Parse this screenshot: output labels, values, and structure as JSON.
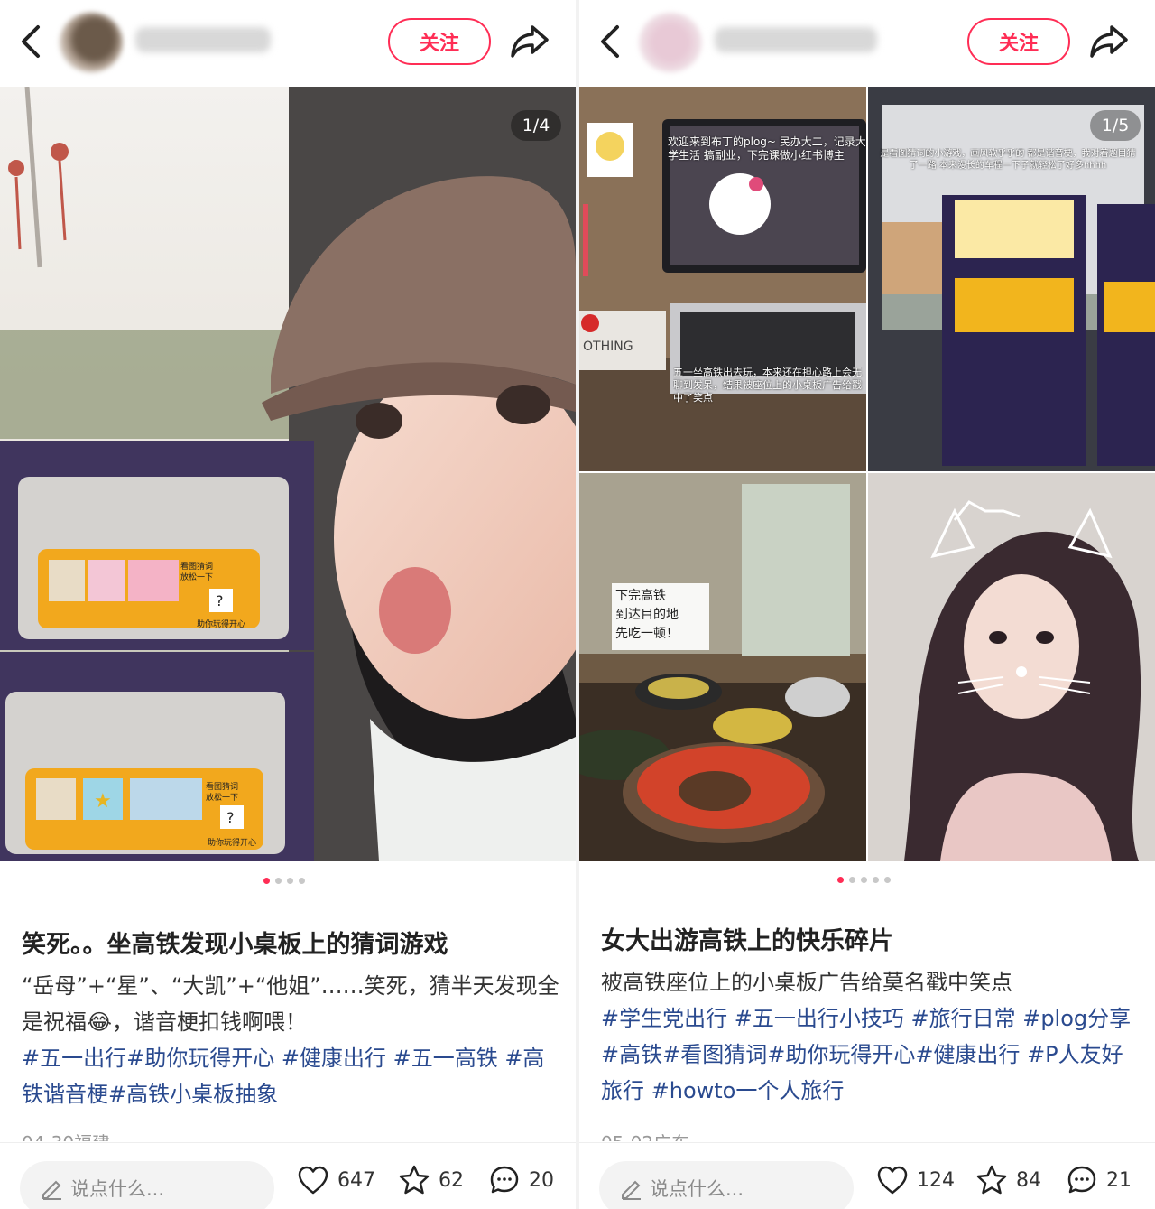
{
  "posts": [
    {
      "header": {
        "username": "███ ████"
      },
      "follow_label": "关注",
      "counter": "1/4",
      "title": "笑死。。坐高铁发现小桌板上的猜词游戏",
      "desc": "“岳母”+“星”、“大凯”+“他姐”……笑死，猜半天发现全是祝福😂，谐音梗扣钱啊喂！",
      "tags": "#五一出行#助你玩得开心 #健康出行 #五一高铁 #高铁谐音梗#高铁小桌板抽象",
      "date": "04-30福建",
      "bottom": {
        "comment_placeholder": "说点什么...",
        "likes": "647",
        "stars": "62",
        "comments": "20"
      },
      "pager": {
        "total": 4,
        "active": 0
      },
      "photo_text": {
        "poster_a_title": "看图猜词\n放松一下",
        "poster_a_footer": "助你玩得开心",
        "poster_a_q": "?",
        "poster_b_title": "看图猜词\n放松一下",
        "poster_b_footer": "助你玩得开心",
        "poster_b_q": "?"
      }
    },
    {
      "header": {
        "username": "███ ███████"
      },
      "follow_label": "关注",
      "counter": "1/5",
      "title": "女大出游高铁上的快乐碎片",
      "desc": "被高铁座位上的小桌板广告给莫名戳中笑点",
      "tags": "#学生党出行 #五一出行小技巧 #旅行日常 #plog分享#高铁#看图猜词#助你玩得开心#健康出行 #P人友好旅行 #howto一个人旅行",
      "date": "05-02广东",
      "bottom": {
        "comment_placeholder": "说点什么...",
        "likes": "124",
        "stars": "84",
        "comments": "21"
      },
      "pager": {
        "total": 5,
        "active": 0
      },
      "photo_text": {
        "laptop_caption": "欢迎来到布丁的plog~ 民办大二，记录大学生活 搞副业，下完课做小红书博主",
        "desk_caption": "五一坐高铁出去玩，本来还在担心路上会无聊到发呆，结果被座位上的小桌板广告给戳中了笑点",
        "train_caption": "是看图猜词的小游戏，画风软乎乎的 都是谐音梗，我对着题目猜了一路 本来漫长的车程一下子就轻松了好多hhhh",
        "food_caption": "下完高铁\n到达目的地\n先吃一顿！",
        "book_text": "OTHING"
      }
    }
  ],
  "colors": {
    "accent": "#ff2d55",
    "tag": "#2a4a8f",
    "muted": "#999999"
  }
}
